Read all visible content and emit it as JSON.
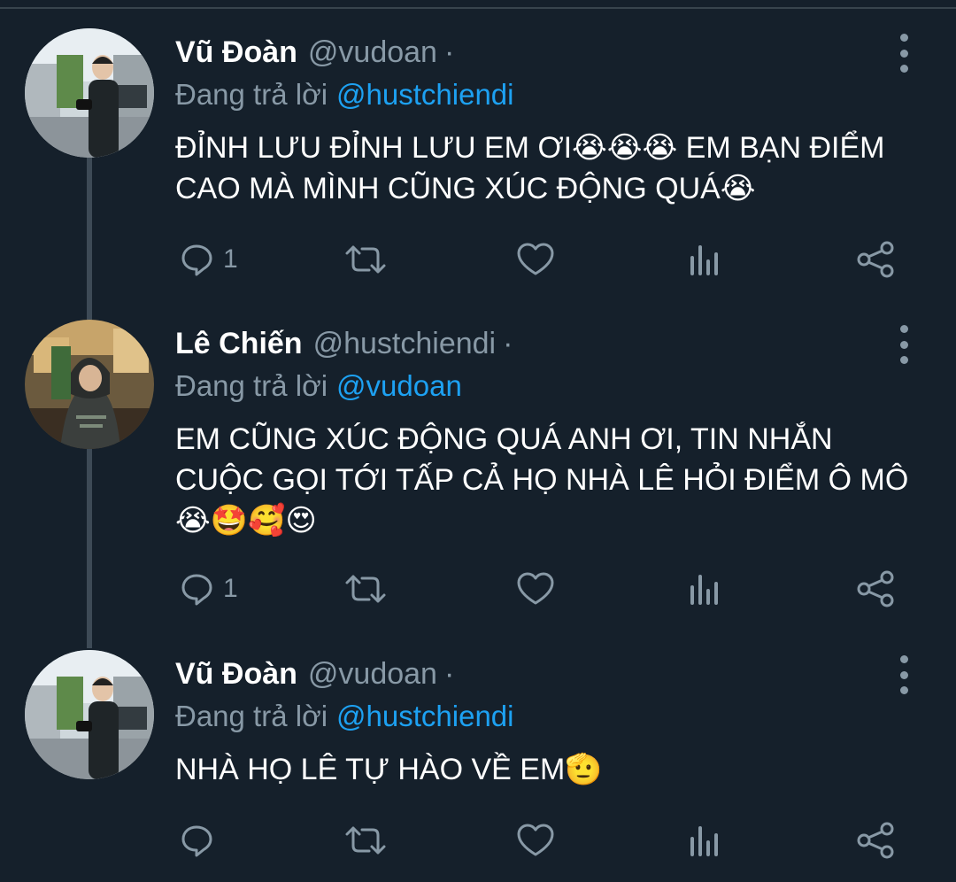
{
  "colors": {
    "background": "#15202b",
    "text": "#ffffff",
    "secondary": "#8899a6",
    "accent": "#1da1f2",
    "thread_line": "#3d4a56"
  },
  "tweets": [
    {
      "name": "Vũ Đoàn",
      "handle": "@vudoan",
      "dot": "·",
      "reply_prefix": "Đang trả lời",
      "reply_to": "@hustchiendi",
      "text": "ĐỈNH LƯU ĐỈNH LƯU EM ƠI😭😭😭 EM BẠN ĐIỂM\nCAO MÀ MÌNH CŨNG XÚC ĐỘNG QUÁ😭",
      "reply_count": "1",
      "avatar": "photo-of-man-on-street"
    },
    {
      "name": "Lê Chiến",
      "handle": "@hustchiendi",
      "dot": "·",
      "reply_prefix": "Đang trả lời",
      "reply_to": "@vudoan",
      "text": "EM CŨNG XÚC ĐỘNG QUÁ ANH ƠI, TIN NHẮN\nCUỘC GỌI TỚI TẤP CẢ HỌ NHÀ LÊ HỎI ĐIỂM Ô MÔ\n😭🤩🥰😍",
      "reply_count": "1",
      "avatar": "photo-of-man-in-hoodie-cafe"
    },
    {
      "name": "Vũ Đoàn",
      "handle": "@vudoan",
      "dot": "·",
      "reply_prefix": "Đang trả lời",
      "reply_to": "@hustchiendi",
      "text": "NHÀ HỌ LÊ TỰ HÀO VỀ EM🫡",
      "reply_count": "",
      "avatar": "photo-of-man-on-street"
    }
  ],
  "action_icons": [
    "reply-icon",
    "retweet-icon",
    "like-icon",
    "analytics-icon",
    "share-icon"
  ]
}
